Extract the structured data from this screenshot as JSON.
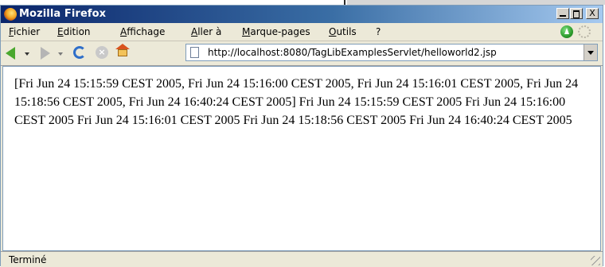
{
  "window": {
    "title": "Mozilla Firefox",
    "icons": {
      "app": "firefox-logo",
      "minimize": "minimize-icon",
      "maximize": "maximize-icon",
      "close": "close-icon"
    },
    "close_glyph": "X"
  },
  "menu": {
    "items": [
      "Fichier",
      "Edition",
      "Affichage",
      "Aller à",
      "Marque-pages",
      "Outils",
      "?"
    ]
  },
  "toolbar": {
    "icons": [
      "back-arrow-icon",
      "forward-arrow-icon",
      "reload-icon",
      "stop-icon",
      "home-icon"
    ],
    "stop_glyph": "×",
    "go_icon": "go-arrow-icon",
    "throbber_icon": "throbber-icon"
  },
  "address": {
    "url": "http://localhost:8080/TagLibExamplesServlet/helloworld2.jsp",
    "page_icon": "page-icon"
  },
  "page": {
    "body_text": "[Fri Jun 24 15:15:59 CEST 2005, Fri Jun 24 15:16:00 CEST 2005, Fri Jun 24 15:16:01 CEST 2005, Fri Jun 24 15:18:56 CEST 2005, Fri Jun 24 16:40:24 CEST 2005] Fri Jun 24 15:15:59 CEST 2005 Fri Jun 24 15:16:00 CEST 2005 Fri Jun 24 15:16:01 CEST 2005 Fri Jun 24 15:18:56 CEST 2005 Fri Jun 24 16:40:24 CEST 2005"
  },
  "status": {
    "text": "Terminé"
  },
  "colors": {
    "titlebar_start": "#0a246a",
    "titlebar_end": "#a6caf0",
    "chrome": "#ece9d8"
  }
}
